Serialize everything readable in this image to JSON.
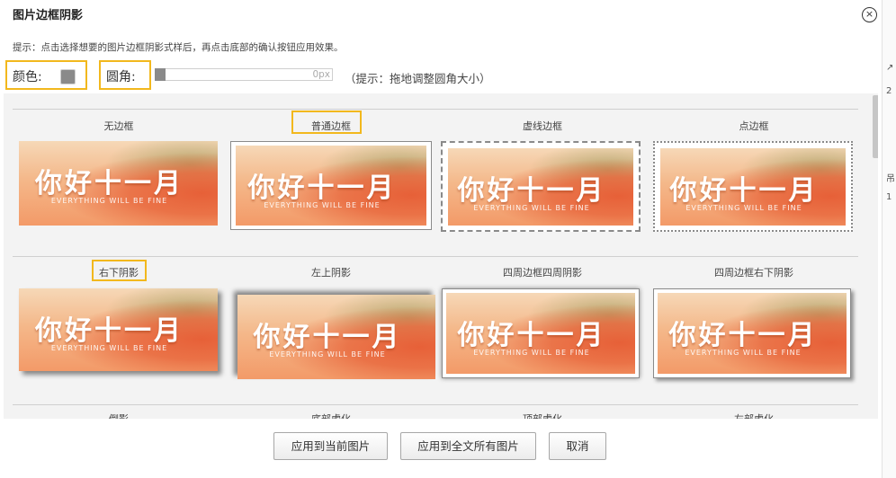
{
  "dialog": {
    "title": "图片边框阴影",
    "close_symbol": "×",
    "hint": "提示：点击选择想要的图片边框阴影式样后，再点击底部的确认按钮应用效果。",
    "color_label": "颜色:",
    "color_value": "#8a8a8a",
    "radius_label": "圆角:",
    "radius_value": "0px",
    "radius_hint": "（提示：拖地调整圆角大小）"
  },
  "thumbnail": {
    "headline": "你好十一月",
    "subline": "EVERYTHING WILL BE FINE"
  },
  "styles": [
    {
      "label": "无边框"
    },
    {
      "label": "普通边框"
    },
    {
      "label": "虚线边框"
    },
    {
      "label": "点边框"
    },
    {
      "label": "右下阴影"
    },
    {
      "label": "左上阴影"
    },
    {
      "label": "四周边框四周阴影"
    },
    {
      "label": "四周边框右下阴影"
    },
    {
      "label": "倒影"
    },
    {
      "label": "底部虚化"
    },
    {
      "label": "顶部虚化"
    },
    {
      "label": "左部虚化"
    }
  ],
  "buttons": {
    "apply_current": "应用到当前图片",
    "apply_all": "应用到全文所有图片",
    "cancel": "取消"
  },
  "sidebar": {
    "chars": [
      "↗",
      "2",
      "吊",
      "1"
    ]
  }
}
